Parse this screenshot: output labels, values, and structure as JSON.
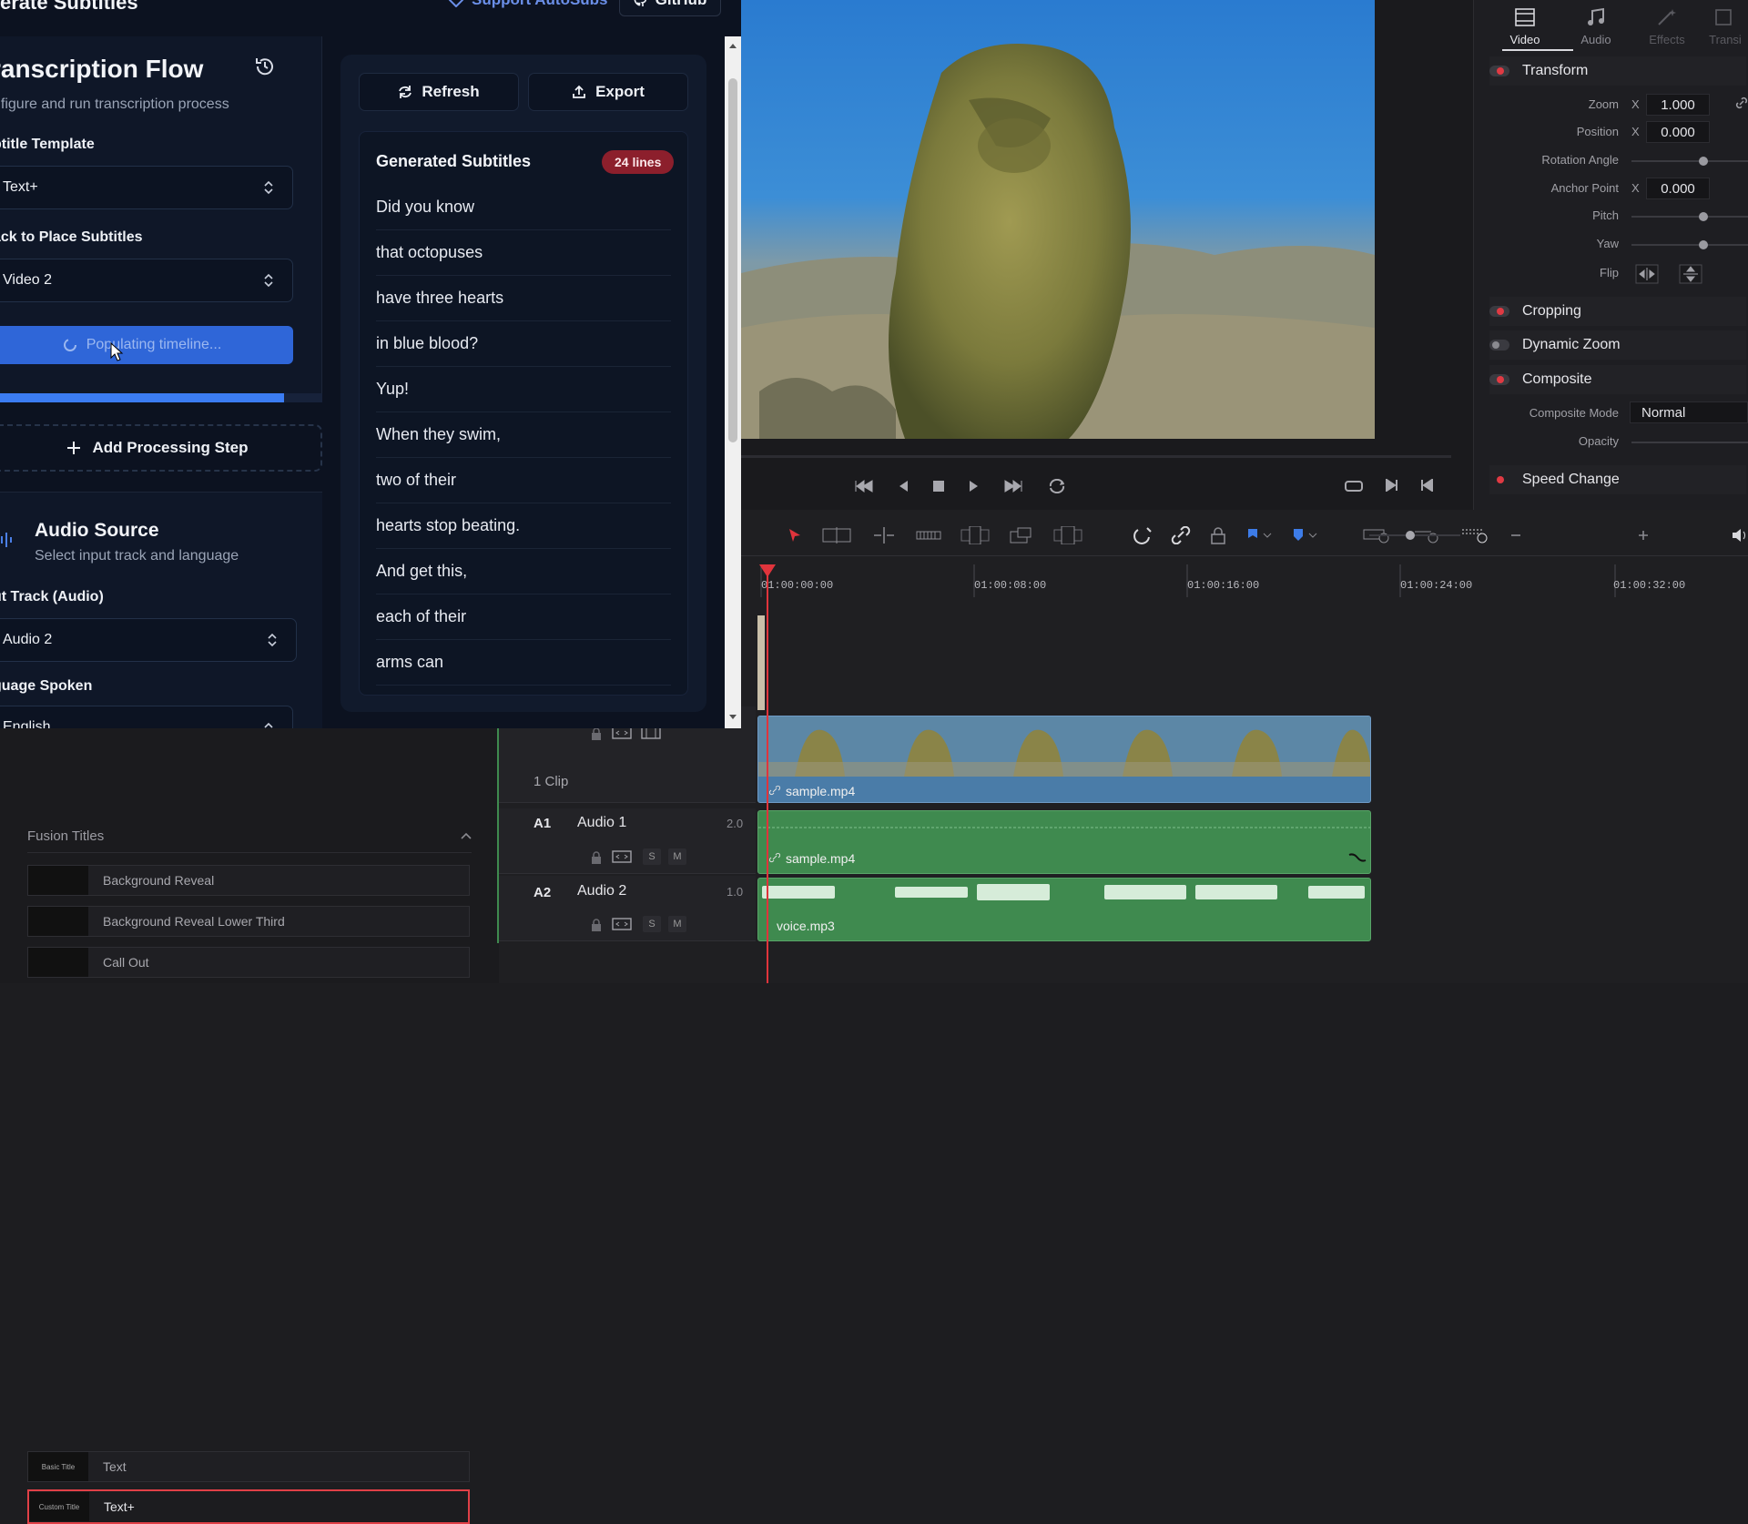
{
  "autosubs": {
    "header_title": "erate Subtitles",
    "support_label": "Support AutoSubs",
    "github_label": "GitHub",
    "flow_title": "ranscription Flow",
    "flow_subtitle": "nfigure and run transcription process",
    "template_label": "btitle Template",
    "template_value": "Text+",
    "track_label": "ack to Place Subtitles",
    "track_value": "Video 2",
    "primary_button": "Populating timeline...",
    "progress_fraction": 0.88,
    "add_step_label": "Add Processing Step",
    "audio_source_title": "Audio Source",
    "audio_source_subtitle": "Select input track and language",
    "input_track_label": "ut Track (Audio)",
    "input_track_value": "Audio 2",
    "language_label": "guage Spoken",
    "language_value": "English",
    "refresh_label": "Refresh",
    "export_label": "Export",
    "subs_header": "Generated Subtitles",
    "lines_badge": "24 lines",
    "subtitles": [
      "Did you know",
      "that octopuses",
      "have three hearts",
      "in blue blood?",
      "Yup!",
      "When they swim,",
      "two of their",
      "hearts stop beating.",
      "And get this,",
      "each of their",
      "arms can"
    ]
  },
  "library": {
    "rows": [
      {
        "thumb": "Basic Title",
        "label": "Text"
      },
      {
        "thumb": "Custom Title",
        "label": "Text+"
      }
    ],
    "fusion_section": "Fusion Titles",
    "fusion_rows": [
      {
        "label": "Background Reveal"
      },
      {
        "label": "Background Reveal Lower Third"
      },
      {
        "label": "Call Out"
      }
    ]
  },
  "inspector": {
    "tabs": [
      "Video",
      "Audio",
      "Effects",
      "Transi"
    ],
    "transform": "Transform",
    "zoom_label": "Zoom",
    "zoom_axis": "X",
    "zoom_value": "1.000",
    "position_label": "Position",
    "position_axis": "X",
    "position_value": "0.000",
    "rotation_label": "Rotation Angle",
    "anchor_label": "Anchor Point",
    "anchor_axis": "X",
    "anchor_value": "0.000",
    "pitch_label": "Pitch",
    "yaw_label": "Yaw",
    "flip_label": "Flip",
    "cropping": "Cropping",
    "dynamic_zoom": "Dynamic Zoom",
    "composite": "Composite",
    "composite_mode_label": "Composite Mode",
    "composite_mode_value": "Normal",
    "opacity_label": "Opacity",
    "speed_change": "Speed Change"
  },
  "timeline": {
    "ruler": [
      "01:00:00:00",
      "01:00:08:00",
      "01:00:16:00",
      "01:00:24:00",
      "01:00:32:00"
    ],
    "video_clip_count": "1 Clip",
    "video_clip_name": "sample.mp4",
    "audio1_id": "A1",
    "audio1_name": "Audio 1",
    "audio1_channels": "2.0",
    "audio1_clip": "sample.mp4",
    "audio2_id": "A2",
    "audio2_name": "Audio 2",
    "audio2_channels": "1.0",
    "audio2_clip": "voice.mp3",
    "solo": "S",
    "mute": "M"
  },
  "colors": {
    "accent_blue": "#2f66d8",
    "badge_red": "#8c1f2c",
    "clip_video": "#4a7ca8",
    "clip_audio": "#3f8a4f",
    "playhead": "#e0343c"
  }
}
